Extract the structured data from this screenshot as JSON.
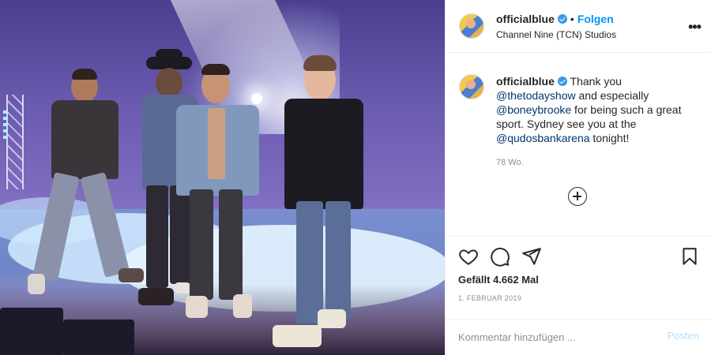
{
  "post": {
    "image_alt": "",
    "header": {
      "username": "officialblue",
      "separator": "•",
      "follow_label": "Folgen",
      "location": "Channel Nine (TCN) Studios",
      "more_glyph": "•••"
    },
    "caption": {
      "username": "officialblue",
      "text_1": " Thank you ",
      "mention_1": "@thetodayshow",
      "text_2": " and especially ",
      "mention_2": "@boneybrooke",
      "text_3": " for being such a great sport. Sydney see you at the ",
      "mention_3": "@qudosbankarena",
      "text_4": " tonight!",
      "time_ago": "78 Wo."
    },
    "stats": {
      "likes": "Gefällt 4.662 Mal",
      "date": "1. FEBRUAR 2019"
    },
    "comment": {
      "placeholder": "Kommentar hinzufügen ...",
      "post_label": "Posten"
    },
    "colors": {
      "accent": "#0095f6",
      "verified": "#3897f0",
      "mention": "#00376b",
      "muted": "#8e8e8e"
    },
    "icons": [
      "verified-badge-icon",
      "more-options-icon",
      "load-more-comments-icon",
      "heart-icon",
      "comment-icon",
      "share-icon",
      "bookmark-icon"
    ]
  }
}
